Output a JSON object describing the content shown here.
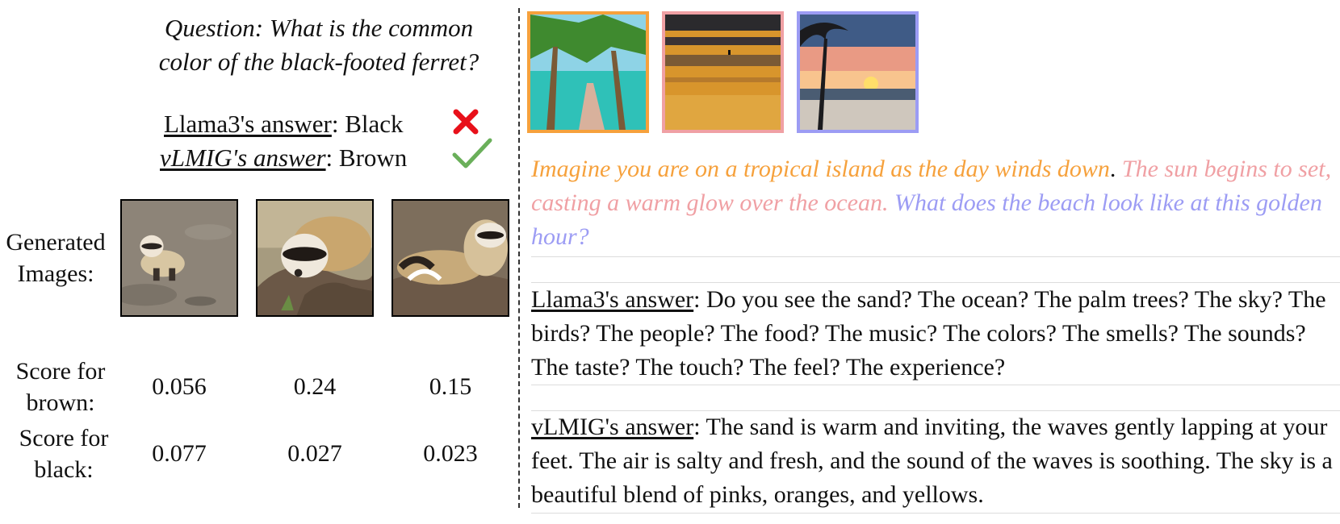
{
  "left": {
    "question": "Question: What is the common color of the black-footed ferret?",
    "question_line1": "Question: What is the common",
    "question_line2": "color of the black-footed ferret?",
    "llama": {
      "name": "Llama3's answer",
      "sep": ": ",
      "value": "Black",
      "mark": "✖",
      "mark_color": "#e8101a"
    },
    "vlmig": {
      "name": "vLMIG's answer",
      "sep": ": ",
      "value": "Brown",
      "mark": "✔",
      "mark_color": "#6aaf5a"
    },
    "generated_label_1": "Generated",
    "generated_label_2": "Images:",
    "brown_label_1": "Score for",
    "brown_label_2": "brown:",
    "black_label_1": "Score for",
    "black_label_2": "black:",
    "images": [
      {
        "icon": "ferret-image",
        "brown": "0.056",
        "black": "0.077"
      },
      {
        "icon": "ferret-image",
        "brown": "0.24",
        "black": "0.027"
      },
      {
        "icon": "ferret-image",
        "brown": "0.15",
        "black": "0.023"
      }
    ]
  },
  "right": {
    "images": [
      {
        "icon": "beach-boardwalk-image",
        "border_color": "#f6a13c"
      },
      {
        "icon": "beach-waves-image",
        "border_color": "#f0a0a4"
      },
      {
        "icon": "beach-sunset-image",
        "border_color": "#9c9cf4"
      }
    ],
    "prompt": [
      {
        "text": "Imagine you are on a tropical island as the day winds down",
        "color": "#f6a13c"
      },
      {
        "text": ". ",
        "color": "#111111"
      },
      {
        "text": "The sun begins to set, casting a warm glow over the ocean. ",
        "color": "#f0a0a4"
      },
      {
        "text": "What does the beach look like at this golden hour?",
        "color": "#9c9cf4"
      }
    ],
    "llama_answer": {
      "name": "Llama3's answer",
      "sep": ": ",
      "text": "Do you see the sand? The ocean? The palm trees? The sky? The birds? The people? The food? The music? The colors? The smells? The sounds? The taste? The touch? The feel? The experience?"
    },
    "vlmig_answer": {
      "name": "vLMIG's answer",
      "sep": ": ",
      "text": "The sand is warm and inviting, the waves gently lapping at your feet. The air is salty and fresh, and the sound of the waves is soothing. The sky is a beautiful blend of pinks, oranges, and yellows."
    }
  }
}
